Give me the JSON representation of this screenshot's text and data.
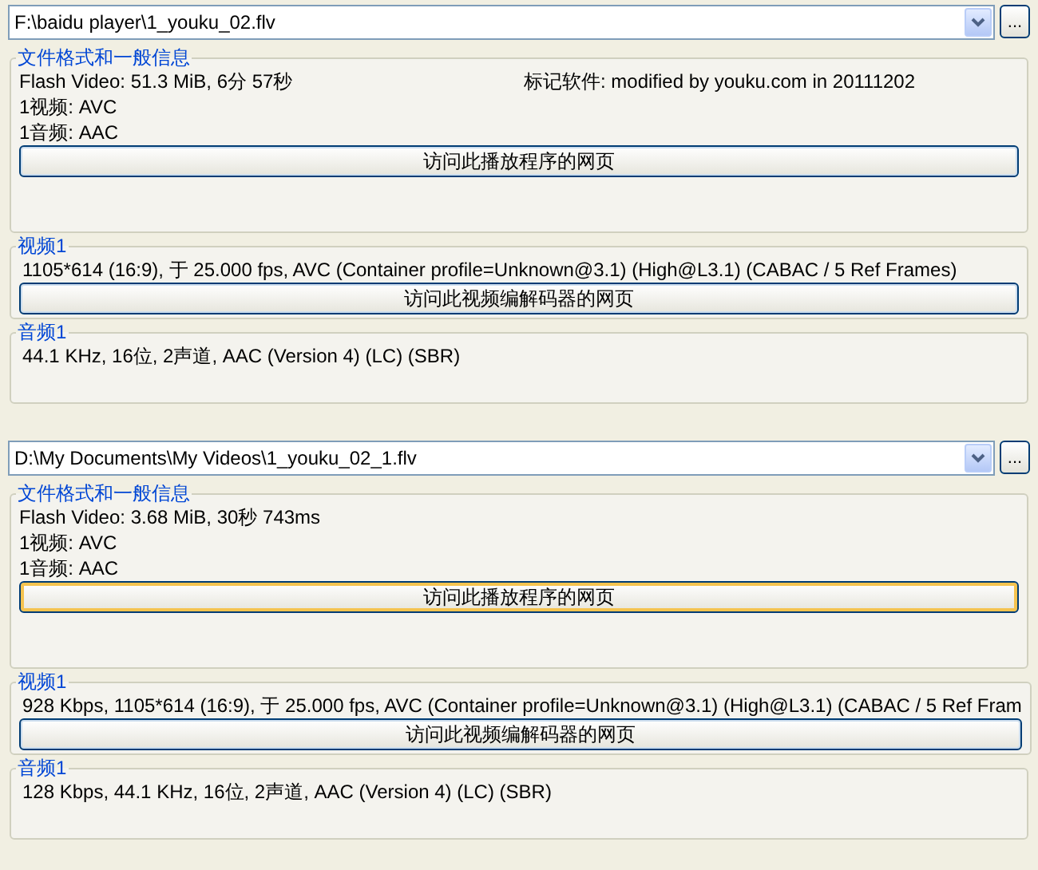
{
  "panels": [
    {
      "file_path": "F:\\baidu player\\1_youku_02.flv",
      "browse_button": "...",
      "general": {
        "title": "文件格式和一般信息",
        "lines": [
          "Flash Video: 51.3 MiB, 6分 57秒",
          "1视频: AVC",
          "1音频: AAC"
        ],
        "tag": "标记软件: modified by youku.com in 20111202",
        "button": {
          "label": "访问此播放程序的网页",
          "hovered": false
        }
      },
      "video": {
        "title": "视频1",
        "lines": [
          "1105*614 (16:9), 于 25.000 fps, AVC (Container profile=Unknown@3.1) (High@L3.1) (CABAC / 5 Ref Frames)"
        ],
        "button": "访问此视频编解码器的网页"
      },
      "audio": {
        "title": "音频1",
        "lines": [
          "44.1 KHz, 16位, 2声道, AAC (Version 4) (LC) (SBR)"
        ]
      }
    },
    {
      "file_path": "D:\\My Documents\\My Videos\\1_youku_02_1.flv",
      "browse_button": "...",
      "general": {
        "title": "文件格式和一般信息",
        "lines": [
          "Flash Video: 3.68 MiB, 30秒 743ms",
          "1视频: AVC",
          "1音频: AAC"
        ],
        "button": {
          "label": "访问此播放程序的网页",
          "hovered": true
        }
      },
      "video": {
        "title": "视频1",
        "lines": [
          "928 Kbps, 1105*614 (16:9), 于 25.000 fps, AVC (Container profile=Unknown@3.1) (High@L3.1) (CABAC / 5 Ref Fram"
        ],
        "button": "访问此视频编解码器的网页"
      },
      "audio": {
        "title": "音频1",
        "lines": [
          "128 Kbps, 44.1 KHz, 16位, 2声道, AAC (Version 4) (LC) (SBR)"
        ]
      }
    }
  ]
}
